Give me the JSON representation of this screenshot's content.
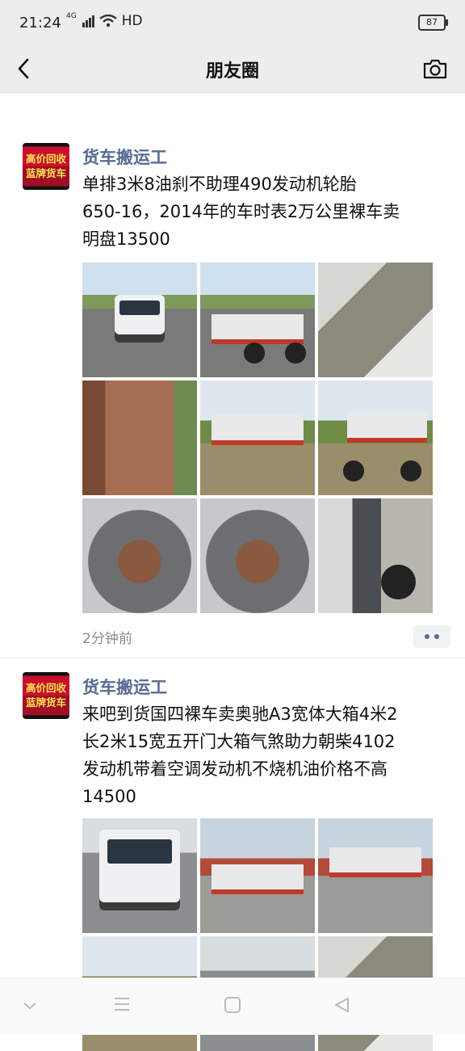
{
  "status_bar": {
    "time": "21:24",
    "network": "4G",
    "hd": "HD",
    "battery": "87"
  },
  "nav": {
    "title": "朋友圈",
    "back_icon": "chevron-left-icon",
    "camera_icon": "camera-icon"
  },
  "posts": [
    {
      "author": "货车搬运工",
      "avatar_lines": [
        "高价回收",
        "蓝牌货车"
      ],
      "text_lines": [
        "单排3米8油刹不助理490发动机轮胎",
        "650-16，2014年的车时表2万公里裸车卖",
        "明盘13500"
      ],
      "timestamp": "2分钟前"
    },
    {
      "author": "货车搬运工",
      "avatar_lines": [
        "高价回收",
        "蓝牌货车"
      ],
      "text_lines": [
        "来吧到货国四裸车卖奥驰A3宽体大箱4米2",
        "长2米15宽五开门大箱气煞助力朝柴4102",
        "发动机带着空调发动机不烧机油价格不高",
        "14500"
      ]
    }
  ],
  "colors": {
    "author": "#576b95",
    "header_bg": "#ededed",
    "timestamp": "#8a8a8a"
  },
  "system_nav": {
    "icons": [
      "chevron-down-icon",
      "menu-icon",
      "home-square-icon",
      "back-triangle-icon"
    ]
  }
}
